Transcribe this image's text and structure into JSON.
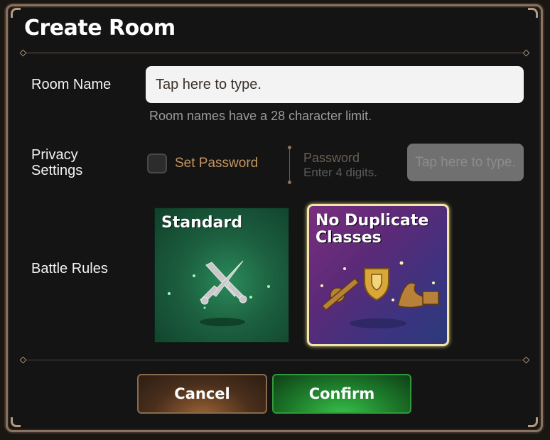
{
  "dialog": {
    "title": "Create Room",
    "room_name": {
      "label": "Room Name",
      "placeholder": "Tap here to type.",
      "hint": "Room names have a 28 character limit."
    },
    "privacy": {
      "label": "Privacy Settings",
      "set_password_label": "Set Password",
      "set_password_checked": false,
      "password_label": "Password",
      "password_sublabel": "Enter 4 digits.",
      "password_placeholder": "Tap here to type."
    },
    "battle_rules": {
      "label": "Battle Rules",
      "options": [
        {
          "title": "Standard",
          "icon": "crossed-swords-icon",
          "selected": false
        },
        {
          "title": "No Duplicate Classes",
          "icon": "class-items-icon",
          "selected": true
        }
      ]
    },
    "buttons": {
      "cancel": "Cancel",
      "confirm": "Confirm"
    }
  },
  "colors": {
    "accent_gold": "#c49560",
    "selected_border": "#f2e6a8",
    "confirm_green": "#1d7a2a",
    "cancel_brown": "#4a2f1c"
  }
}
